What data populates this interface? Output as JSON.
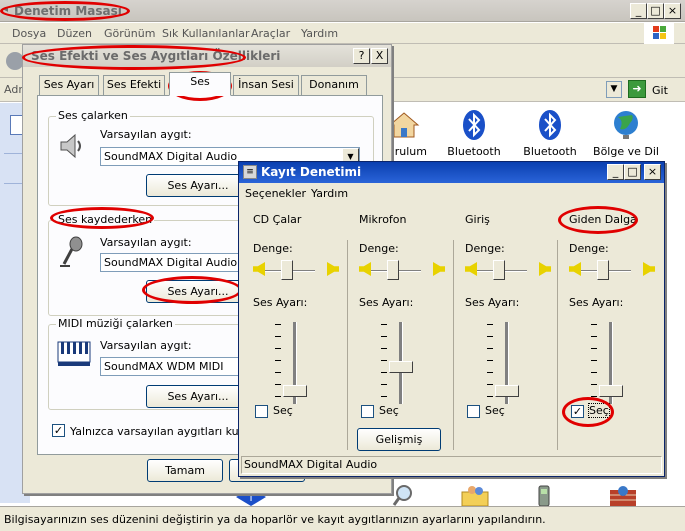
{
  "control_panel": {
    "title": "Denetim Masası",
    "menu": [
      "Dosya",
      "Düzen",
      "Görünüm",
      "Sık Kullanılanlar",
      "Araçlar",
      "Yardım"
    ],
    "address_label": "Adr",
    "go_label": "Git",
    "icons": [
      {
        "label": "Kurulum",
        "icon": "house-icon"
      },
      {
        "label": "Bluetooth Aygıtları",
        "icon": "bluetooth-icon"
      },
      {
        "label": "Bluetooth Yapılandırma",
        "icon": "bluetooth-icon"
      },
      {
        "label": "Bölge ve Dil Seçenekleri",
        "icon": "globe-icon"
      }
    ],
    "status_text": "Bilgisayarınızın ses düzenini değiştirin ya da hoparlör ve kayıt aygıtlarınızın ayarlarını yapılandırın."
  },
  "sound_dialog": {
    "title": "Ses Efekti ve Ses Aygıtları Özellikleri",
    "help_btn": "?",
    "close_btn": "X",
    "tabs": [
      "Ses Ayarı",
      "Ses Efekti",
      "Ses",
      "İnsan Sesi",
      "Donanım"
    ],
    "active_tab": "Ses",
    "playback": {
      "group": "Ses çalarken",
      "default_label": "Varsayılan aygıt:",
      "device": "SoundMAX Digital Audio",
      "volume_btn": "Ses Ayarı..."
    },
    "recording": {
      "group": "Ses kaydederken",
      "default_label": "Varsayılan aygıt:",
      "device": "SoundMAX Digital Audio",
      "volume_btn": "Ses Ayarı..."
    },
    "midi": {
      "group": "MIDI müziği çalarken",
      "default_label": "Varsayılan aygıt:",
      "device": "SoundMAX WDM MIDI",
      "volume_btn": "Ses Ayarı..."
    },
    "only_default_label": "Yalnızca varsayılan aygıtları kullan",
    "only_default_checked": true,
    "ok_btn": "Tamam"
  },
  "recording_control": {
    "title": "Kayıt Denetimi",
    "menu": [
      "Seçenekler",
      "Yardım"
    ],
    "balance_label": "Denge:",
    "volume_label": "Ses Ayarı:",
    "select_label": "Seç",
    "advanced_btn": "Gelişmiş",
    "status": "SoundMAX Digital Audio",
    "columns": [
      {
        "name": "CD Çalar",
        "selected": false,
        "volume": 0.1
      },
      {
        "name": "Mikrofon",
        "selected": false,
        "volume": 0.45
      },
      {
        "name": "Giriş",
        "selected": false,
        "volume": 0.1
      },
      {
        "name": "Giden Dalga",
        "selected": true,
        "volume": 0.1
      }
    ]
  },
  "colors": {
    "highlight_oval": "#e00000",
    "active_title": "#0a3fb0",
    "dialog_bg": "#ece9d8"
  }
}
